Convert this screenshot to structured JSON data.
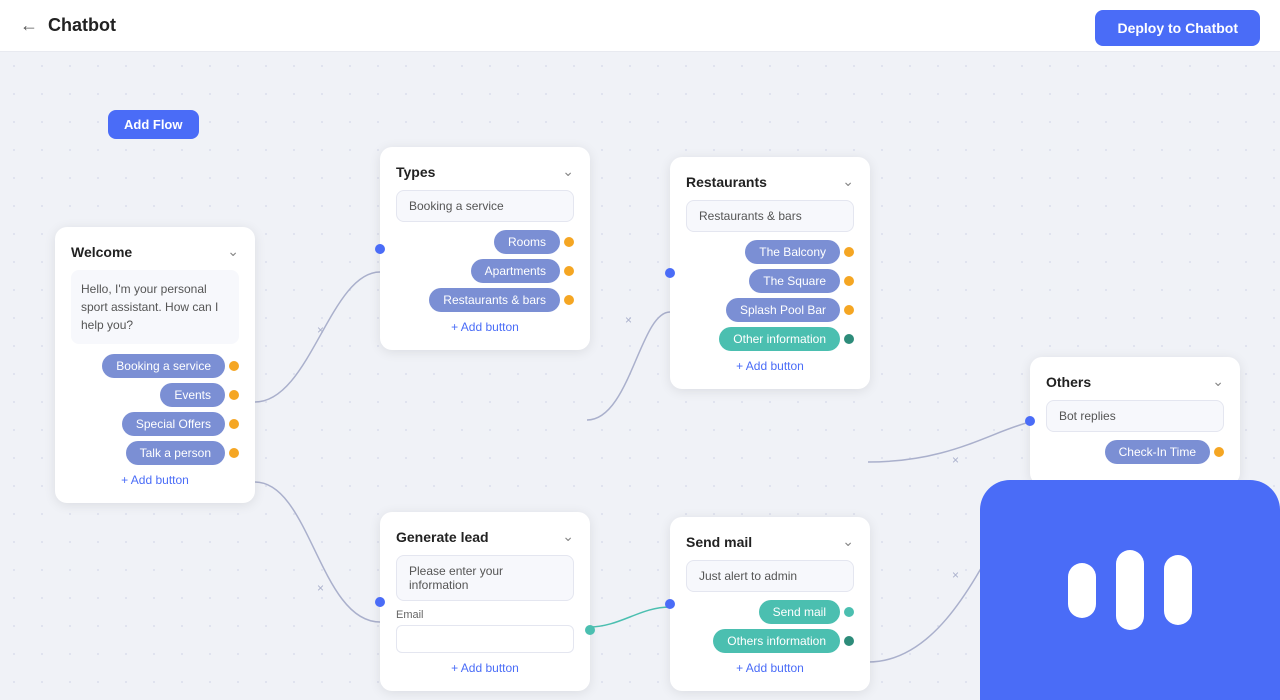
{
  "header": {
    "back_icon": "←",
    "title": "Chatbot",
    "deploy_label": "Deploy to Chatbot"
  },
  "toolbar": {
    "add_flow_label": "Add Flow"
  },
  "welcome_card": {
    "title": "Welcome",
    "body": "Hello, I'm your personal sport assistant. How can I help you?",
    "buttons": [
      {
        "label": "Booking a service"
      },
      {
        "label": "Events"
      },
      {
        "label": "Special Offers"
      },
      {
        "label": "Talk a person"
      }
    ],
    "add_button_label": "+ Add button"
  },
  "types_card": {
    "title": "Types",
    "input_value": "Booking a service",
    "buttons": [
      {
        "label": "Rooms"
      },
      {
        "label": "Apartments"
      },
      {
        "label": "Restaurants & bars"
      }
    ],
    "add_button_label": "+ Add button"
  },
  "restaurants_card": {
    "title": "Restaurants",
    "input_value": "Restaurants & bars",
    "buttons": [
      {
        "label": "The Balcony"
      },
      {
        "label": "The Square"
      },
      {
        "label": "Splash Pool Bar"
      },
      {
        "label": "Other information"
      }
    ],
    "add_button_label": "+ Add button"
  },
  "others_card": {
    "title": "Others",
    "input_value": "Bot replies",
    "buttons": [
      {
        "label": "Check-In Time"
      }
    ]
  },
  "generate_card": {
    "title": "Generate lead",
    "input_value": "Please enter your information",
    "email_label": "Email",
    "email_placeholder": "",
    "add_button_label": "+ Add button"
  },
  "send_mail_card": {
    "title": "Send mail",
    "input_value": "Just alert to admin",
    "buttons": [
      {
        "label": "Send mail",
        "type": "teal"
      },
      {
        "label": "Others information",
        "type": "teal"
      }
    ],
    "add_button_label": "+ Add button"
  },
  "chatbot_widget": {
    "bars": [
      1,
      0,
      2
    ]
  }
}
